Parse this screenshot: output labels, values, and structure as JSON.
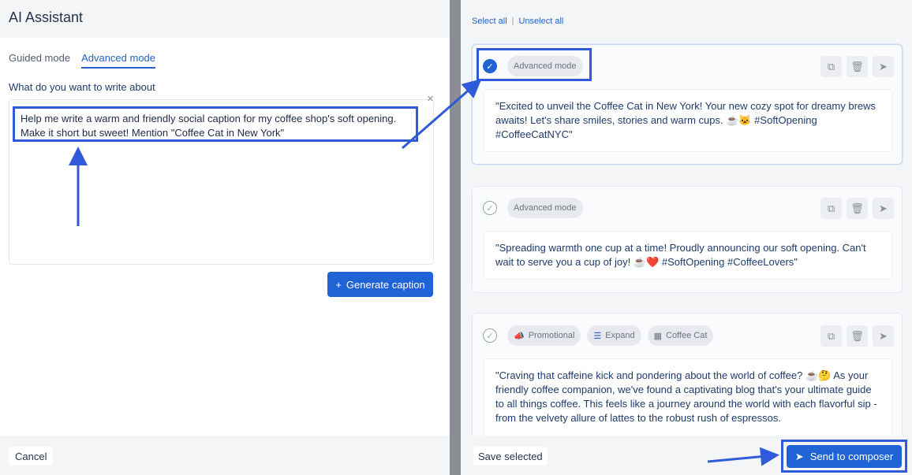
{
  "app": {
    "title": "AI Assistant"
  },
  "modes": {
    "guided": "Guided mode",
    "advanced": "Advanced mode"
  },
  "prompt": {
    "label": "What do you want to write about",
    "text": "Help me write a warm and friendly social caption for my coffee shop's soft opening. Make it short but sweet! Mention \"Coffee Cat in New York\"",
    "clear_icon": "×"
  },
  "generate": {
    "icon": "+",
    "label": "Generate caption"
  },
  "footer_left": {
    "cancel": "Cancel"
  },
  "selection": {
    "select_all": "Select all",
    "separator": "|",
    "unselect_all": "Unselect all"
  },
  "cards": [
    {
      "selected": true,
      "check_icon": "✓",
      "tags": [
        {
          "icon": "",
          "label": "Advanced mode"
        }
      ],
      "text": "\"Excited to unveil the Coffee Cat in New York! Your new cozy spot for dreamy brews awaits! Let's share smiles, stories and warm cups. ☕🐱 #SoftOpening #CoffeeCatNYC\""
    },
    {
      "selected": false,
      "check_icon": "✓",
      "tags": [
        {
          "icon": "",
          "label": "Advanced mode"
        }
      ],
      "text": "\"Spreading warmth one cup at a time! Proudly announcing our soft opening. Can't wait to serve you a cup of joy! ☕❤️ #SoftOpening #CoffeeLovers\""
    },
    {
      "selected": false,
      "check_icon": "✓",
      "tags": [
        {
          "icon": "📣",
          "label": "Promotional"
        },
        {
          "icon": "☰",
          "label": "Expand"
        },
        {
          "icon": "▦",
          "label": "Coffee Cat"
        }
      ],
      "text": "\"Craving that caffeine kick and pondering about the world of coffee? ☕🤔 As your friendly coffee companion, we've found a captivating blog that's your ultimate guide to all things coffee. This feels like a journey around the world with each flavorful sip - from the velvety allure of lattes to the robust rush of espressos."
    }
  ],
  "action_icons": {
    "copy": "⧉",
    "delete": "🗑",
    "send": "➤"
  },
  "footer_right": {
    "save": "Save selected",
    "send_icon": "➤",
    "send": "Send to composer"
  },
  "colors": {
    "accent": "#1f63d6",
    "annotation": "#2f5ad9",
    "divider": "#8a8d93"
  }
}
